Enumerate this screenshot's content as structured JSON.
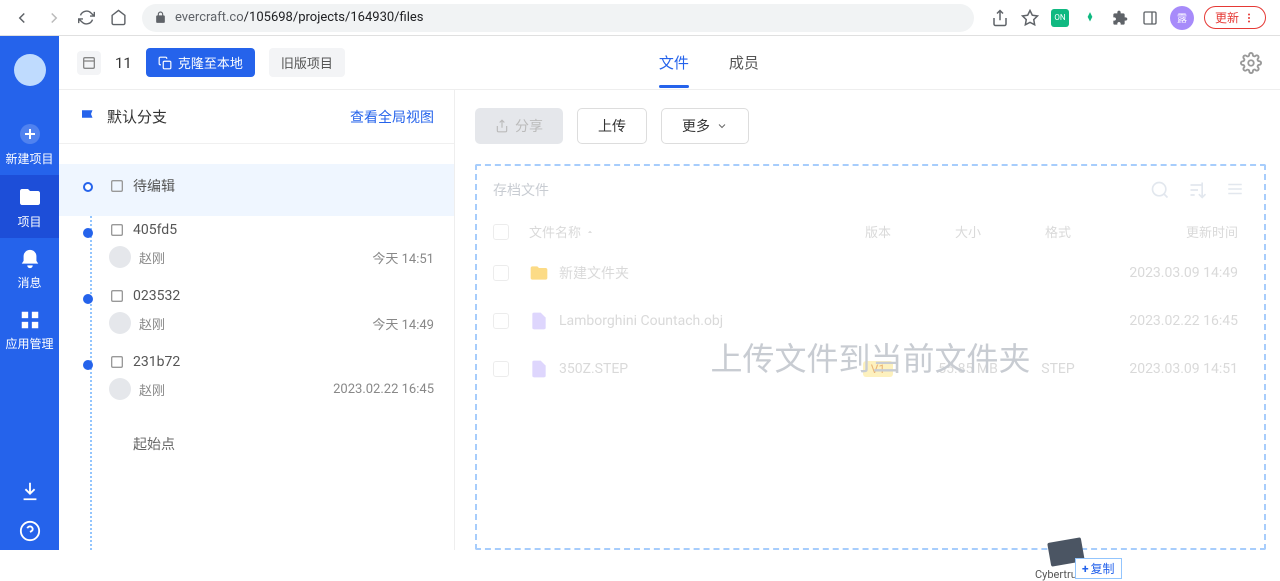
{
  "browser": {
    "url_host": "evercraft.co",
    "url_path": "/105698/projects/164930/files",
    "update_label": "更新"
  },
  "sidebar": {
    "items": [
      {
        "label": "新建项目"
      },
      {
        "label": "项目"
      },
      {
        "label": "消息"
      },
      {
        "label": "应用管理"
      }
    ]
  },
  "topbar": {
    "number": "11",
    "clone_label": "克隆至本地",
    "old_label": "旧版项目",
    "tabs": [
      {
        "label": "文件"
      },
      {
        "label": "成员"
      }
    ]
  },
  "branch": {
    "title": "默认分支",
    "global_view": "查看全局视图",
    "start_label": "起始点"
  },
  "commits": [
    {
      "label": "待编辑",
      "user": "",
      "time": ""
    },
    {
      "label": "405fd5",
      "user": "赵刚",
      "time": "今天 14:51"
    },
    {
      "label": "023532",
      "user": "赵刚",
      "time": "今天 14:49"
    },
    {
      "label": "231b72",
      "user": "赵刚",
      "time": "2023.02.22 16:45"
    }
  ],
  "actions": {
    "share": "分享",
    "upload": "上传",
    "more": "更多"
  },
  "filepanel": {
    "archive": "存档文件",
    "overlay": "上传文件到当前文件夹",
    "headers": {
      "name": "文件名称",
      "version": "版本",
      "size": "大小",
      "format": "格式",
      "time": "更新时间"
    }
  },
  "files": [
    {
      "name": "新建文件夹",
      "version": "",
      "size": "",
      "format": "",
      "time": "2023.03.09 14:49",
      "icon": "folder"
    },
    {
      "name": "Lamborghini Countach.obj",
      "version": "",
      "size": "",
      "format": "",
      "time": "2023.02.22 16:45",
      "icon": "file"
    },
    {
      "name": "350Z.STEP",
      "version": "V1",
      "size": "55.85 MB",
      "format": "STEP",
      "time": "2023.03.09 14:51",
      "icon": "file"
    }
  ],
  "drag": {
    "filename": "Cybertruck...",
    "tip": "复制"
  },
  "avatar_letter": "露"
}
